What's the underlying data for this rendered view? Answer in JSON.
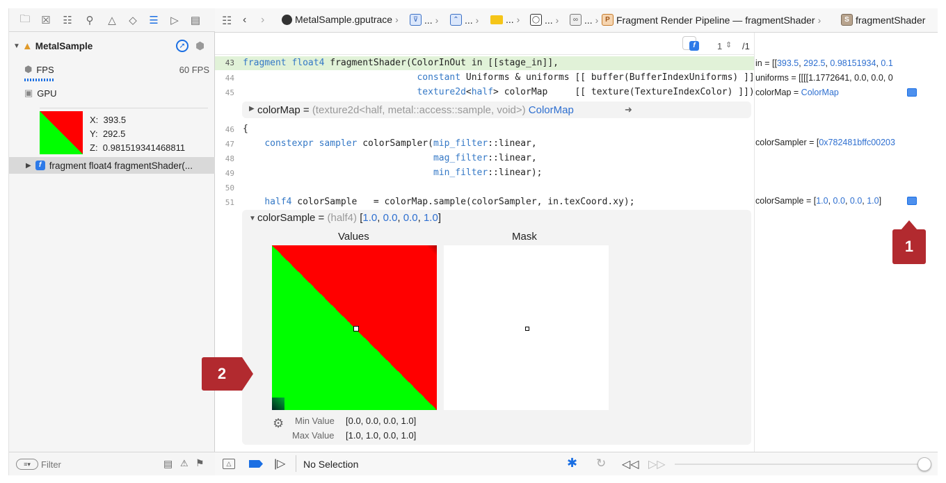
{
  "navigator": {
    "root_label": "MetalSample",
    "fps_label": "FPS",
    "fps_value": "60 FPS",
    "gpu_label": "GPU",
    "pixel": {
      "x_label": "X:",
      "x": "393.5",
      "y_label": "Y:",
      "y": "292.5",
      "z_label": "Z:",
      "z": "0.981519341468811"
    },
    "selected_item": "fragment float4 fragmentShader(...",
    "filter_placeholder": "Filter"
  },
  "jumpbar": {
    "trace": "MetalSample.gputrace",
    "ellipsis": "...",
    "pipeline": "Fragment Render Pipeline — fragmentShader",
    "shader": "fragmentShader",
    "pipeline_badge": "P",
    "shader_badge": "S"
  },
  "editor_header": {
    "page": "1",
    "total": "/1"
  },
  "code": {
    "lines": [
      {
        "num": "43",
        "text": "fragment float4 fragmentShader(ColorInOut in [[stage_in]],"
      },
      {
        "num": "44",
        "text": "                               constant Uniforms & uniforms [[ buffer(BufferIndexUniforms) ]],"
      },
      {
        "num": "45",
        "text": "                               texture2d<half> colorMap     [[ texture(TextureIndexColor) ]])"
      },
      {
        "num": "46",
        "text": "{"
      },
      {
        "num": "47",
        "text": "    constexpr sampler colorSampler(mip_filter::linear,"
      },
      {
        "num": "48",
        "text": "                                   mag_filter::linear,"
      },
      {
        "num": "49",
        "text": "                                   min_filter::linear);"
      },
      {
        "num": "50",
        "text": ""
      },
      {
        "num": "51",
        "text": "    half4 colorSample   = colorMap.sample(colorSampler, in.texCoord.xy);"
      }
    ],
    "colormap_bubble": {
      "name": "colorMap",
      "eq": " = ",
      "type": "(texture2d<half, metal::access::sample, void>)",
      "value": "ColorMap"
    },
    "colorsample_bubble": {
      "name": "colorSample",
      "eq": " = ",
      "type": "(half4)",
      "open": "[",
      "v1": "1.0",
      "v2": "0.0",
      "v3": "0.0",
      "v4": "1.0",
      "close": "]"
    },
    "values_label": "Values",
    "mask_label": "Mask",
    "min_label": "Min Value",
    "min_value": "[0.0, 0.0, 0.0, 1.0]",
    "max_label": "Max Value",
    "max_value": "[1.0, 1.0, 0.0, 1.0]"
  },
  "variables": {
    "in": {
      "name": "in",
      "eq": " = [[",
      "v1": "393.5",
      "v2": "292.5",
      "v3": "0.98151934",
      "v4": "0.1"
    },
    "uniforms": "uniforms = [[[[1.1772641, 0.0, 0.0, 0",
    "colormap": {
      "name": "colorMap",
      "eq": " = ",
      "value": "ColorMap"
    },
    "colorsampler": {
      "name": "colorSampler",
      "eq": " = [",
      "value": "0x782481bffc00203"
    },
    "colorsample": {
      "name": "colorSample",
      "eq": " = [",
      "v1": "1.0",
      "v2": "0.0",
      "v3": "0.0",
      "v4": "1.0",
      "close": "]"
    }
  },
  "bottom": {
    "selection": "No Selection"
  },
  "callouts": {
    "one": "1",
    "two": "2"
  },
  "colors": {
    "accent": "#1b6fe3",
    "callout": "#b22a2f",
    "red": "#ff0000",
    "green": "#00ff00"
  }
}
